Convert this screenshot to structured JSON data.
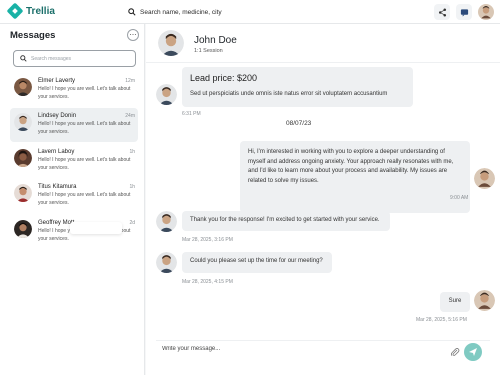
{
  "app": {
    "name": "Trellia"
  },
  "search": {
    "placeholder": "Search name, medicine, city"
  },
  "sidebar": {
    "title": "Messages",
    "search_placeholder": "Search messages",
    "conversations": [
      {
        "name": "Elmer Laverty",
        "time": "12m",
        "preview": "Hello! I hope you are well. Let's talk about your services."
      },
      {
        "name": "Lindsey Donin",
        "time": "24m",
        "preview": "Hello! I hope you are well. Let's talk about your services."
      },
      {
        "name": "Lavern Laboy",
        "time": "1h",
        "preview": "Hello! I hope you are well. Let's talk about your services."
      },
      {
        "name": "Titus Kitamura",
        "time": "1h",
        "preview": "Hello! I hope you are well. Let's talk about your services."
      },
      {
        "name": "Geoffrey Mott",
        "time": "2d",
        "preview": "Hello! I hope you are well. Let's talk about your services."
      }
    ]
  },
  "chat": {
    "name": "John Doe",
    "subtitle": "1:1 Session",
    "lead": {
      "title": "Lead price: $200",
      "body": "Sed ut perspiciatis unde omnis iste natus error sit voluptatem accusantium",
      "time": "6:31 PM"
    },
    "date_separator": "08/07/23",
    "messages": [
      {
        "side": "out",
        "text": "Hi, I'm interested in working with you to explore a deeper understanding of myself and address ongoing anxiety. Your approach really resonates with me, and I'd like to learn more about your process and availability. My issues are related to solve my issues.",
        "time": "9:00 AM"
      },
      {
        "side": "in",
        "text": "Thank you for the response! I'm excited to get started with your service.",
        "time": "Mar 28, 2025, 3:16 PM"
      },
      {
        "side": "in",
        "text": "Could you please set up the time for our meeting?",
        "time": "Mar 28, 2025, 4:15 PM"
      },
      {
        "side": "out",
        "text": "Sure",
        "time": "Mar 28, 2025, 5:16 PM"
      }
    ],
    "composer_placeholder": "Write your message..."
  },
  "colors": {
    "accent": "#19b2a6",
    "send": "#7fcac2",
    "bubble": "#eef0f2"
  }
}
